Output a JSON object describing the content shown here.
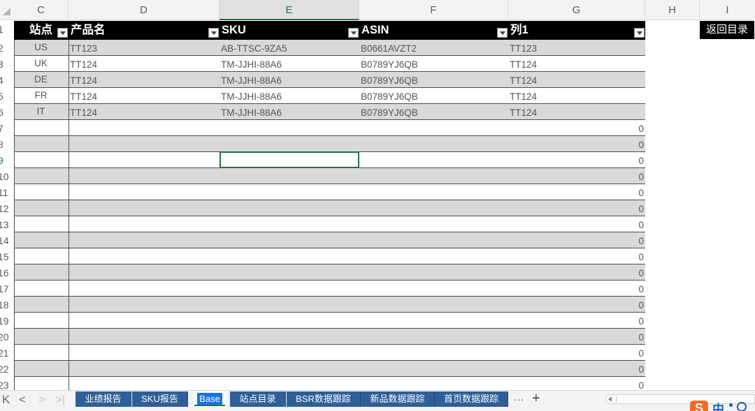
{
  "columns": {
    "visible_headers": [
      "C",
      "D",
      "E",
      "F",
      "G",
      "H",
      "I"
    ],
    "active": "E"
  },
  "table": {
    "headers": [
      "站点",
      "产品名",
      "SKU",
      "ASIN",
      "列1"
    ],
    "rows": [
      {
        "site": "US",
        "product": "TT123",
        "sku": "AB-TTSC-9ZA5",
        "asin": "B0661AVZT2",
        "col1": "TT123"
      },
      {
        "site": "UK",
        "product": "TT124",
        "sku": "TM-JJHI-88A6",
        "asin": "B0789YJ6QB",
        "col1": "TT124"
      },
      {
        "site": "DE",
        "product": "TT124",
        "sku": "TM-JJHI-88A6",
        "asin": "B0789YJ6QB",
        "col1": "TT124"
      },
      {
        "site": "FR",
        "product": "TT124",
        "sku": "TM-JJHI-88A6",
        "asin": "B0789YJ6QB",
        "col1": "TT124"
      },
      {
        "site": "IT",
        "product": "TT124",
        "sku": "TM-JJHI-88A6",
        "asin": "B0789YJ6QB",
        "col1": "TT124"
      }
    ],
    "empty_row_value": "0"
  },
  "row_numbers": [
    "1",
    "2",
    "3",
    "4",
    "5",
    "6",
    "7",
    "8",
    "9",
    "10",
    "11",
    "12",
    "13",
    "14",
    "15",
    "16",
    "17",
    "18",
    "19",
    "20",
    "21",
    "22",
    "23"
  ],
  "active_row": "9",
  "back_link": "返回目录",
  "sheet_tabs": [
    "业绩报告",
    "SKU报告",
    "Base",
    "站点目录",
    "BSR数据跟踪",
    "新品数据跟踪",
    "首页数据跟踪"
  ],
  "active_sheet": "Base",
  "more_tabs": "···",
  "add_sheet": "+",
  "nav": {
    "first": "K",
    "prev": "<",
    "next": ">",
    "last": ">|"
  },
  "ime": {
    "logo": "S",
    "lang": "中"
  },
  "colors": {
    "header_bg": "#000000",
    "band": "#d9d9d9",
    "tab_bg": "#2f5f96",
    "accent": "#217346"
  }
}
